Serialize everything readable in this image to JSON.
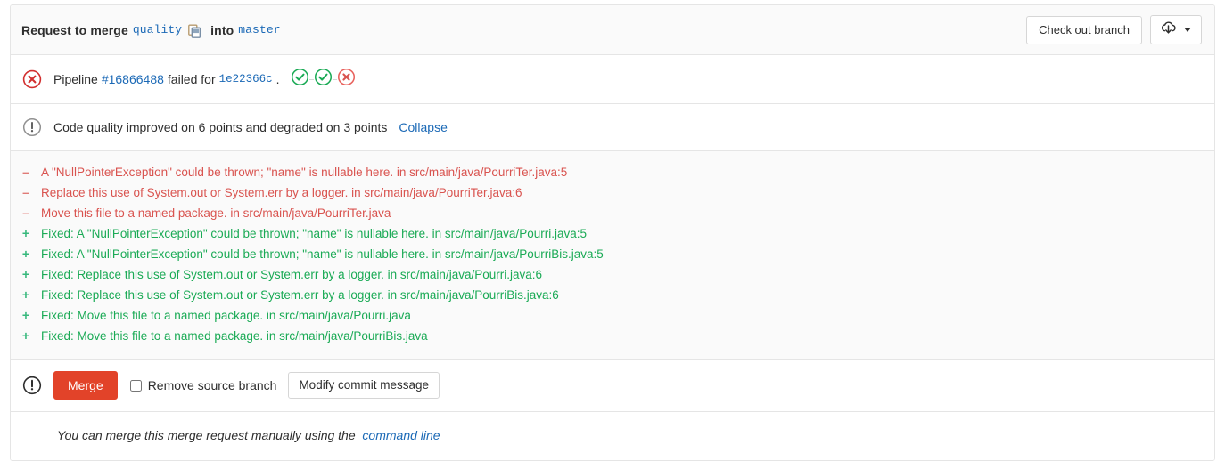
{
  "header": {
    "title_prefix": "Request to merge",
    "source_branch": "quality",
    "copy_icon": "copy-to-clipboard-icon",
    "word_into": "into",
    "target_branch": "master",
    "checkout_button": "Check out branch",
    "download_icon": "cloud-download-icon",
    "dropdown_icon": "chevron-down-icon"
  },
  "pipeline": {
    "status_icon": "status-failed-icon",
    "label": "Pipeline",
    "pipeline_id": "#16866488",
    "status_text": "failed for",
    "commit_sha": "1e22366c",
    "trailing": ".",
    "stages": [
      {
        "name": "stage-passed-icon",
        "status": "success"
      },
      {
        "name": "stage-passed-icon",
        "status": "success"
      },
      {
        "name": "stage-failed-icon",
        "status": "failed"
      }
    ]
  },
  "code_quality": {
    "status_icon": "status-warning-icon",
    "summary": "Code quality improved on 6 points and degraded on 3 points",
    "toggle_label": "Collapse",
    "items": [
      {
        "sign": "–",
        "type": "degraded",
        "text": "A \"NullPointerException\" could be thrown; \"name\" is nullable here. in src/main/java/PourriTer.java:5"
      },
      {
        "sign": "–",
        "type": "degraded",
        "text": "Replace this use of System.out or System.err by a logger. in src/main/java/PourriTer.java:6"
      },
      {
        "sign": "–",
        "type": "degraded",
        "text": "Move this file to a named package. in src/main/java/PourriTer.java"
      },
      {
        "sign": "+",
        "type": "fixed",
        "text": "Fixed: A \"NullPointerException\" could be thrown; \"name\" is nullable here. in src/main/java/Pourri.java:5"
      },
      {
        "sign": "+",
        "type": "fixed",
        "text": "Fixed: A \"NullPointerException\" could be thrown; \"name\" is nullable here. in src/main/java/PourriBis.java:5"
      },
      {
        "sign": "+",
        "type": "fixed",
        "text": "Fixed: Replace this use of System.out or System.err by a logger. in src/main/java/Pourri.java:6"
      },
      {
        "sign": "+",
        "type": "fixed",
        "text": "Fixed: Replace this use of System.out or System.err by a logger. in src/main/java/PourriBis.java:6"
      },
      {
        "sign": "+",
        "type": "fixed",
        "text": "Fixed: Move this file to a named package. in src/main/java/Pourri.java"
      },
      {
        "sign": "+",
        "type": "fixed",
        "text": "Fixed: Move this file to a named package. in src/main/java/PourriBis.java"
      }
    ]
  },
  "merge_actions": {
    "status_icon": "status-warning-dark-icon",
    "merge_button": "Merge",
    "remove_source_branch_label": "Remove source branch",
    "remove_source_branch_checked": false,
    "modify_commit_message_button": "Modify commit message"
  },
  "footer": {
    "text_prefix": "You can merge this merge request manually using the",
    "link_text": "command line"
  },
  "colors": {
    "failed": "#d22f2f",
    "success": "#1aaa55",
    "merge_button": "#e24329",
    "link": "#1b69b6",
    "degraded_text": "#d9534f",
    "fixed_text": "#1aaa55",
    "panel_bg": "#fafafa",
    "border": "#e5e5e5"
  }
}
